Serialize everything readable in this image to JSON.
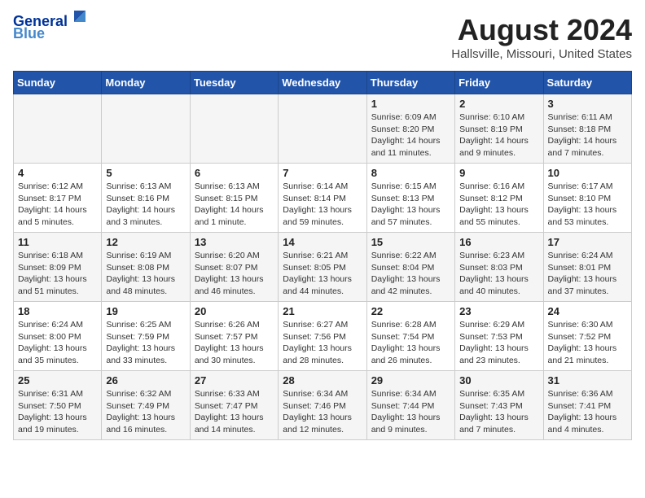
{
  "header": {
    "logo_line1": "General",
    "logo_line2": "Blue",
    "month_year": "August 2024",
    "location": "Hallsville, Missouri, United States"
  },
  "days_of_week": [
    "Sunday",
    "Monday",
    "Tuesday",
    "Wednesday",
    "Thursday",
    "Friday",
    "Saturday"
  ],
  "weeks": [
    [
      {
        "day": "",
        "info": ""
      },
      {
        "day": "",
        "info": ""
      },
      {
        "day": "",
        "info": ""
      },
      {
        "day": "",
        "info": ""
      },
      {
        "day": "1",
        "info": "Sunrise: 6:09 AM\nSunset: 8:20 PM\nDaylight: 14 hours\nand 11 minutes."
      },
      {
        "day": "2",
        "info": "Sunrise: 6:10 AM\nSunset: 8:19 PM\nDaylight: 14 hours\nand 9 minutes."
      },
      {
        "day": "3",
        "info": "Sunrise: 6:11 AM\nSunset: 8:18 PM\nDaylight: 14 hours\nand 7 minutes."
      }
    ],
    [
      {
        "day": "4",
        "info": "Sunrise: 6:12 AM\nSunset: 8:17 PM\nDaylight: 14 hours\nand 5 minutes."
      },
      {
        "day": "5",
        "info": "Sunrise: 6:13 AM\nSunset: 8:16 PM\nDaylight: 14 hours\nand 3 minutes."
      },
      {
        "day": "6",
        "info": "Sunrise: 6:13 AM\nSunset: 8:15 PM\nDaylight: 14 hours\nand 1 minute."
      },
      {
        "day": "7",
        "info": "Sunrise: 6:14 AM\nSunset: 8:14 PM\nDaylight: 13 hours\nand 59 minutes."
      },
      {
        "day": "8",
        "info": "Sunrise: 6:15 AM\nSunset: 8:13 PM\nDaylight: 13 hours\nand 57 minutes."
      },
      {
        "day": "9",
        "info": "Sunrise: 6:16 AM\nSunset: 8:12 PM\nDaylight: 13 hours\nand 55 minutes."
      },
      {
        "day": "10",
        "info": "Sunrise: 6:17 AM\nSunset: 8:10 PM\nDaylight: 13 hours\nand 53 minutes."
      }
    ],
    [
      {
        "day": "11",
        "info": "Sunrise: 6:18 AM\nSunset: 8:09 PM\nDaylight: 13 hours\nand 51 minutes."
      },
      {
        "day": "12",
        "info": "Sunrise: 6:19 AM\nSunset: 8:08 PM\nDaylight: 13 hours\nand 48 minutes."
      },
      {
        "day": "13",
        "info": "Sunrise: 6:20 AM\nSunset: 8:07 PM\nDaylight: 13 hours\nand 46 minutes."
      },
      {
        "day": "14",
        "info": "Sunrise: 6:21 AM\nSunset: 8:05 PM\nDaylight: 13 hours\nand 44 minutes."
      },
      {
        "day": "15",
        "info": "Sunrise: 6:22 AM\nSunset: 8:04 PM\nDaylight: 13 hours\nand 42 minutes."
      },
      {
        "day": "16",
        "info": "Sunrise: 6:23 AM\nSunset: 8:03 PM\nDaylight: 13 hours\nand 40 minutes."
      },
      {
        "day": "17",
        "info": "Sunrise: 6:24 AM\nSunset: 8:01 PM\nDaylight: 13 hours\nand 37 minutes."
      }
    ],
    [
      {
        "day": "18",
        "info": "Sunrise: 6:24 AM\nSunset: 8:00 PM\nDaylight: 13 hours\nand 35 minutes."
      },
      {
        "day": "19",
        "info": "Sunrise: 6:25 AM\nSunset: 7:59 PM\nDaylight: 13 hours\nand 33 minutes."
      },
      {
        "day": "20",
        "info": "Sunrise: 6:26 AM\nSunset: 7:57 PM\nDaylight: 13 hours\nand 30 minutes."
      },
      {
        "day": "21",
        "info": "Sunrise: 6:27 AM\nSunset: 7:56 PM\nDaylight: 13 hours\nand 28 minutes."
      },
      {
        "day": "22",
        "info": "Sunrise: 6:28 AM\nSunset: 7:54 PM\nDaylight: 13 hours\nand 26 minutes."
      },
      {
        "day": "23",
        "info": "Sunrise: 6:29 AM\nSunset: 7:53 PM\nDaylight: 13 hours\nand 23 minutes."
      },
      {
        "day": "24",
        "info": "Sunrise: 6:30 AM\nSunset: 7:52 PM\nDaylight: 13 hours\nand 21 minutes."
      }
    ],
    [
      {
        "day": "25",
        "info": "Sunrise: 6:31 AM\nSunset: 7:50 PM\nDaylight: 13 hours\nand 19 minutes."
      },
      {
        "day": "26",
        "info": "Sunrise: 6:32 AM\nSunset: 7:49 PM\nDaylight: 13 hours\nand 16 minutes."
      },
      {
        "day": "27",
        "info": "Sunrise: 6:33 AM\nSunset: 7:47 PM\nDaylight: 13 hours\nand 14 minutes."
      },
      {
        "day": "28",
        "info": "Sunrise: 6:34 AM\nSunset: 7:46 PM\nDaylight: 13 hours\nand 12 minutes."
      },
      {
        "day": "29",
        "info": "Sunrise: 6:34 AM\nSunset: 7:44 PM\nDaylight: 13 hours\nand 9 minutes."
      },
      {
        "day": "30",
        "info": "Sunrise: 6:35 AM\nSunset: 7:43 PM\nDaylight: 13 hours\nand 7 minutes."
      },
      {
        "day": "31",
        "info": "Sunrise: 6:36 AM\nSunset: 7:41 PM\nDaylight: 13 hours\nand 4 minutes."
      }
    ]
  ]
}
